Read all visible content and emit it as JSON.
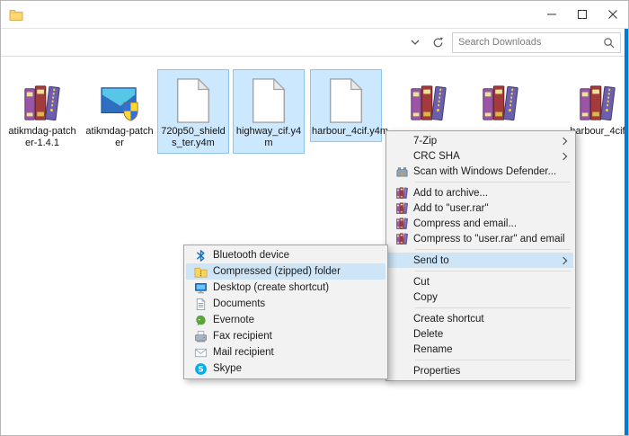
{
  "window": {
    "search_placeholder": "Search Downloads"
  },
  "colors": {
    "accent": "#0078d7",
    "selection": "#cce8ff",
    "menu_highlight": "#cde5f7"
  },
  "files": [
    {
      "name": "atikmdag-patcher-1.4.1",
      "icon": "winrar-archive",
      "selected": false
    },
    {
      "name": "atikmdag-patcher",
      "icon": "app-with-uac-shield",
      "selected": false
    },
    {
      "name": "720p50_shields_ter.y4m",
      "icon": "blank-page",
      "selected": true
    },
    {
      "name": "highway_cif.y4m",
      "icon": "blank-page",
      "selected": true
    },
    {
      "name": "harbour_4cif.y4m",
      "icon": "blank-page",
      "selected": true
    },
    {
      "name": "",
      "icon": "winrar-archive",
      "selected": false
    },
    {
      "name": "",
      "icon": "winrar-archive",
      "selected": false
    },
    {
      "name": "harbour_4cif",
      "icon": "winrar-archive",
      "selected": false
    }
  ],
  "context_menu": {
    "items": [
      {
        "label": "7-Zip",
        "submenu": true
      },
      {
        "label": "CRC SHA",
        "submenu": true
      },
      {
        "label": "Scan with Windows Defender...",
        "icon": "defender"
      },
      {
        "label": "Add to archive...",
        "icon": "winrar"
      },
      {
        "label": "Add to \"user.rar\"",
        "icon": "winrar"
      },
      {
        "label": "Compress and email...",
        "icon": "winrar"
      },
      {
        "label": "Compress to \"user.rar\" and email",
        "icon": "winrar"
      },
      {
        "label": "Send to",
        "submenu": true,
        "highlighted": true
      },
      {
        "label": "Cut"
      },
      {
        "label": "Copy"
      },
      {
        "label": "Create shortcut"
      },
      {
        "label": "Delete"
      },
      {
        "label": "Rename"
      },
      {
        "label": "Properties"
      }
    ]
  },
  "send_to_menu": {
    "items": [
      {
        "label": "Bluetooth device",
        "icon": "bluetooth"
      },
      {
        "label": "Compressed (zipped) folder",
        "icon": "zipped-folder",
        "highlighted": true
      },
      {
        "label": "Desktop (create shortcut)",
        "icon": "desktop"
      },
      {
        "label": "Documents",
        "icon": "documents"
      },
      {
        "label": "Evernote",
        "icon": "evernote"
      },
      {
        "label": "Fax recipient",
        "icon": "fax"
      },
      {
        "label": "Mail recipient",
        "icon": "mail"
      },
      {
        "label": "Skype",
        "icon": "skype"
      }
    ]
  }
}
